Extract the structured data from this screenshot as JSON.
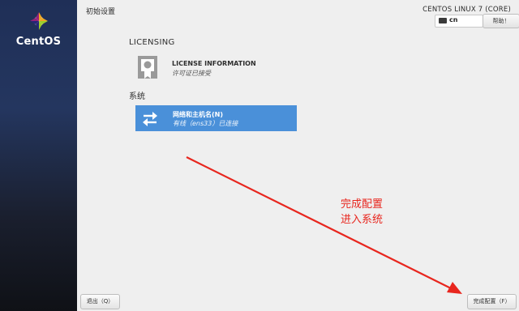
{
  "brand": {
    "logo_text": "CentOS",
    "logo_icon": "centos-logo-icon"
  },
  "header": {
    "title": "初始设置",
    "os_version": "CENTOS LINUX 7 (CORE)"
  },
  "keyboard": {
    "icon": "keyboard-icon",
    "layout": "cn"
  },
  "help": {
    "label": "帮助！"
  },
  "sections": {
    "licensing": {
      "title": "LICENSING",
      "spokes": [
        {
          "icon": "certificate-icon",
          "name": "LICENSE INFORMATION",
          "status": "许可证已接受"
        }
      ]
    },
    "system": {
      "title": "系统",
      "spokes": [
        {
          "icon": "network-arrows-icon",
          "name": "网络和主机名(N)",
          "status": "有线（ens33）已连接",
          "selected": true
        }
      ]
    }
  },
  "annotation": {
    "line1": "完成配置",
    "line2": "进入系统",
    "color": "#e8261e"
  },
  "buttons": {
    "quit": "退出（Q）",
    "finish": "完成配置（F）"
  },
  "colors": {
    "accent": "#4a90d9",
    "sidebar": "#1f2f57"
  }
}
